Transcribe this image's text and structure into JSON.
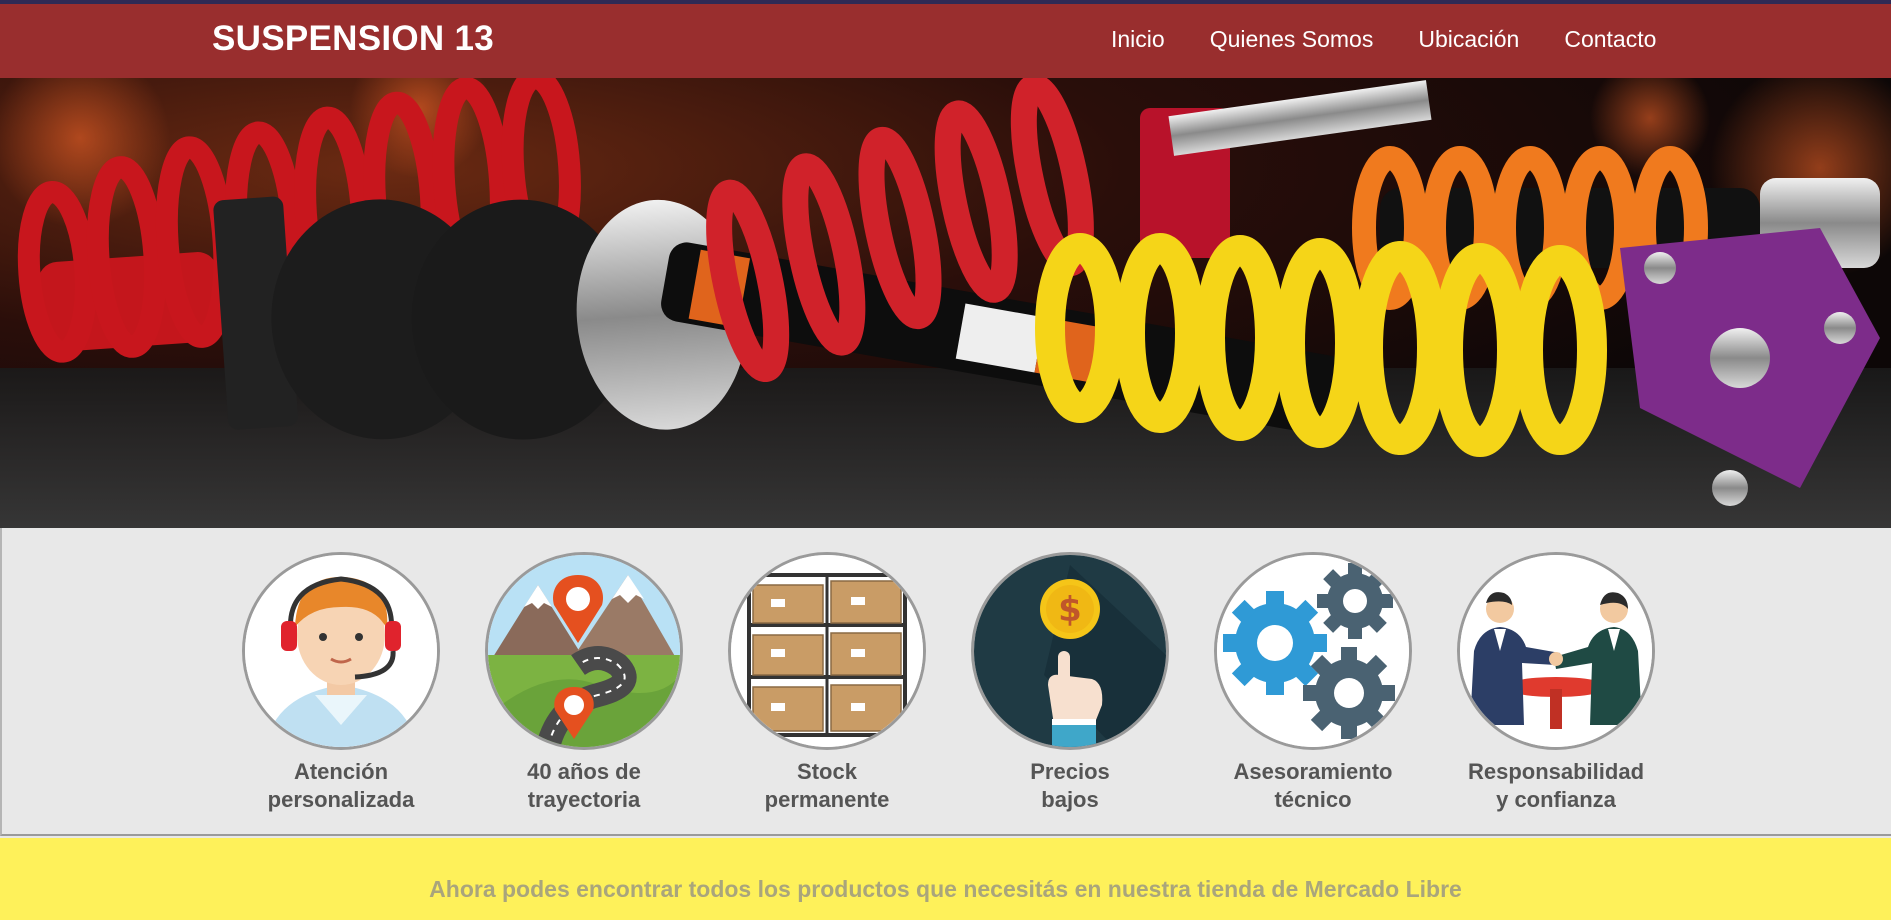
{
  "header": {
    "brand": "SUSPENSION 13",
    "nav": [
      "Inicio",
      "Quienes Somos",
      "Ubicación",
      "Contacto"
    ]
  },
  "hero": {
    "image": "suspension-coilovers-photo"
  },
  "features": [
    {
      "label": "Atención\npersonalizada",
      "icon": "support-agent-icon"
    },
    {
      "label": "40 años de\ntrayectoria",
      "icon": "road-map-pin-icon"
    },
    {
      "label": "Stock\npermanente",
      "icon": "warehouse-boxes-icon"
    },
    {
      "label": "Precios\nbajos",
      "icon": "dollar-coin-icon"
    },
    {
      "label": "Asesoramiento\ntécnico",
      "icon": "gears-icon"
    },
    {
      "label": "Responsabilidad\ny confianza",
      "icon": "handshake-icon"
    }
  ],
  "promo": {
    "text": "Ahora podes encontrar todos los productos que necesitás en nuestra tienda de Mercado Libre"
  },
  "colors": {
    "header_bg": "#992e2e",
    "promo_bg": "#fef15a",
    "features_bg": "#e8e8e8"
  }
}
